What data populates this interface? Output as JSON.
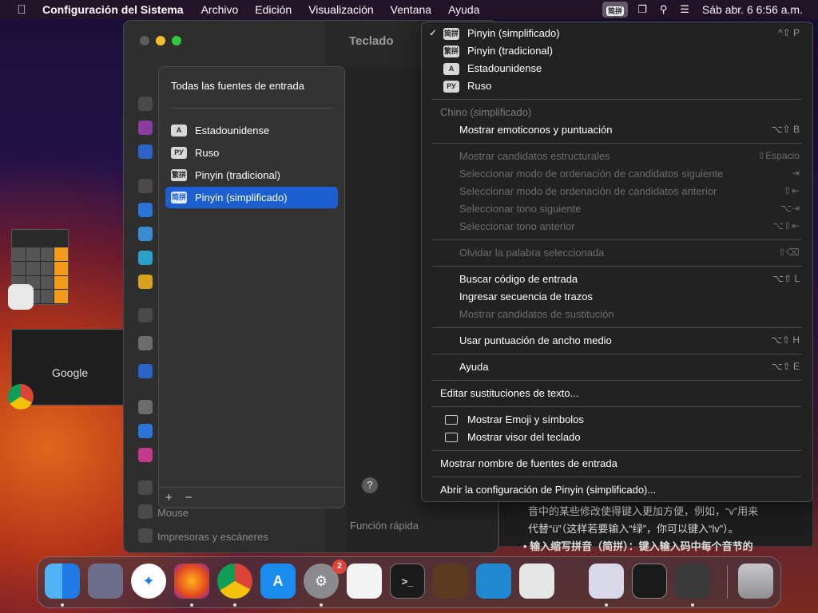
{
  "menubar": {
    "app_name": "Configuración del Sistema",
    "menus": [
      "Archivo",
      "Edición",
      "Visualización",
      "Ventana",
      "Ayuda"
    ],
    "ime_indicator": "简拼",
    "clock": "Sáb abr. 6  6:56 a.m."
  },
  "window": {
    "title": "Teclado",
    "sidebar_bottom": [
      "Mouse",
      "Impresoras y escáneres"
    ],
    "quick_function": "Función rápida"
  },
  "sources_sheet": {
    "title": "Todas las fuentes de entrada",
    "items": [
      {
        "badge": "A",
        "label": "Estadounidense"
      },
      {
        "badge": "РУ",
        "label": "Ruso"
      },
      {
        "badge": "繁拼",
        "label": "Pinyin (tradicional)"
      },
      {
        "badge": "简拼",
        "label": "Pinyin (simplificado)"
      }
    ],
    "add": "+",
    "remove": "−",
    "help": "?"
  },
  "menu": {
    "sources": [
      {
        "check": "✓",
        "badge": "简拼",
        "label": "Pinyin (simplificado)",
        "shortcut": "^⇧ P"
      },
      {
        "check": "",
        "badge": "繁拼",
        "label": "Pinyin (tradicional)",
        "shortcut": ""
      },
      {
        "check": "",
        "badge": "A",
        "label": "Estadounidense",
        "shortcut": ""
      },
      {
        "check": "",
        "badge": "РУ",
        "label": "Ruso",
        "shortcut": ""
      }
    ],
    "section_header": "Chino (simplificado)",
    "emoticons": {
      "label": "Mostrar emoticonos y puntuación",
      "shortcut": "⌥⇧ B"
    },
    "structural": [
      {
        "label": "Mostrar candidatos estructurales",
        "shortcut": "⇧Espacio"
      },
      {
        "label": "Seleccionar modo de ordenación de candidatos siguiente",
        "shortcut": "⇥"
      },
      {
        "label": "Seleccionar modo de ordenación de candidatos anterior",
        "shortcut": "⇧⇤"
      },
      {
        "label": "Seleccionar tono siguiente",
        "shortcut": "⌥⇥"
      },
      {
        "label": "Seleccionar tono anterior",
        "shortcut": "⌥⇧⇤"
      }
    ],
    "forget": {
      "label": "Olvidar la palabra seleccionada",
      "shortcut": "⇧⌫"
    },
    "search_code": {
      "label": "Buscar código de entrada",
      "shortcut": "⌥⇧ L"
    },
    "strokes": {
      "label": "Ingresar secuencia de trazos",
      "shortcut": ""
    },
    "substitution": {
      "label": "Mostrar candidatos de sustitución",
      "shortcut": ""
    },
    "half_width": {
      "label": "Usar puntuación de ancho medio",
      "shortcut": "⌥⇧ H"
    },
    "help": {
      "label": "Ayuda",
      "shortcut": "⌥⇧ E"
    },
    "edit_subs": "Editar sustituciones de texto...",
    "emoji": "Mostrar Emoji y símbolos",
    "keyboard_viewer": "Mostrar visor del teclado",
    "show_names": "Mostrar nombre de fuentes de entrada",
    "open_settings": "Abrir la configuración de Pinyin (simplificado)..."
  },
  "behind_text": {
    "line1": "音中的某些修改使得键入更加方便，例如，“v”用来",
    "line2": "代替“ü”（这样若要输入“绿”，你可以键入“lv”）。",
    "line3": "•  输入缩写拼音（简拼）：键入输入码中每个音节的"
  },
  "previews": {
    "google_label": "Google"
  },
  "dock": {
    "badge_count": "2",
    "terminal_glyph": ">_"
  },
  "colors": {
    "accent": "#1c5fd3",
    "menu_bg": "#232223"
  }
}
